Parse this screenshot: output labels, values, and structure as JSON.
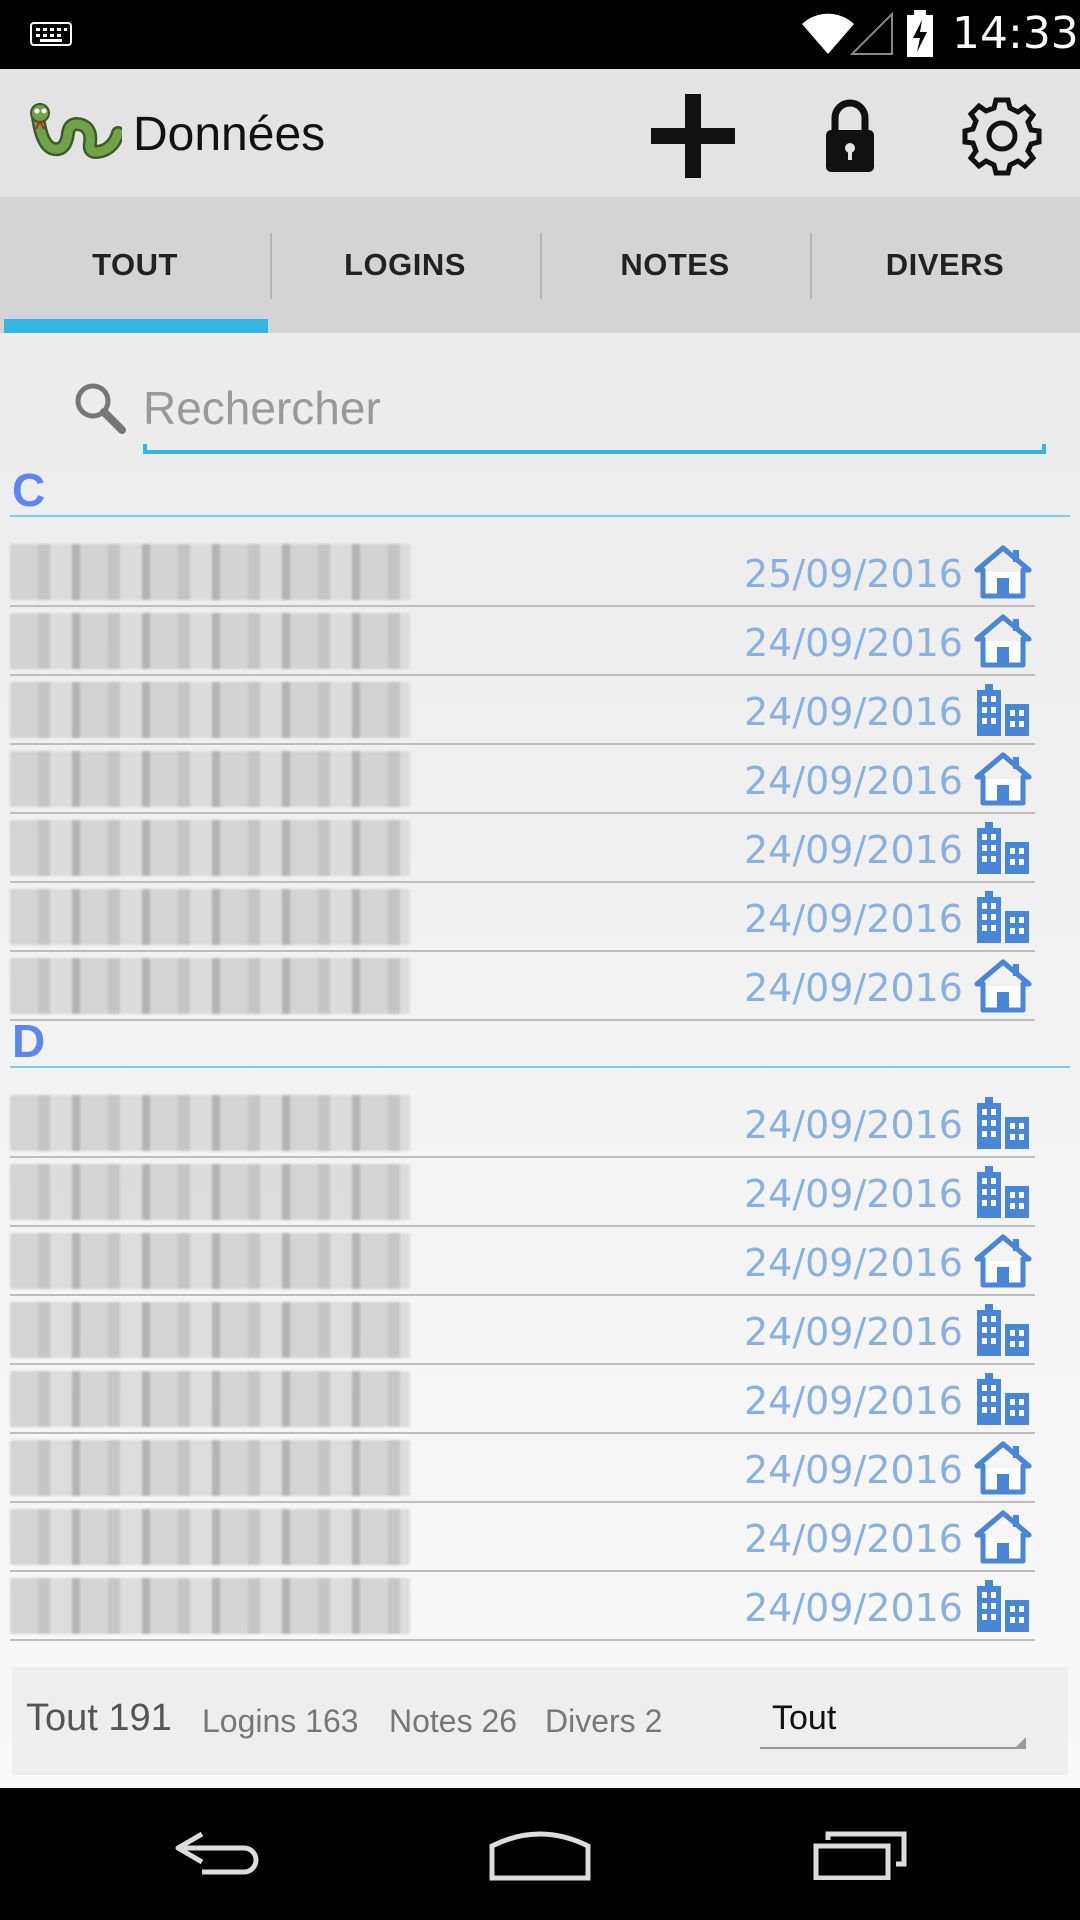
{
  "status_bar": {
    "time": "14:33",
    "icons": [
      "keyboard-icon",
      "wifi-icon",
      "signal-icon",
      "battery-icon"
    ]
  },
  "action_bar": {
    "title": "Données",
    "logo": "snake-logo",
    "actions": [
      "add-icon",
      "lock-icon",
      "gear-icon"
    ]
  },
  "tabs": [
    {
      "label": "TOUT",
      "active": true
    },
    {
      "label": "LOGINS",
      "active": false
    },
    {
      "label": "NOTES",
      "active": false
    },
    {
      "label": "DIVERS",
      "active": false
    }
  ],
  "search": {
    "placeholder": "Rechercher",
    "value": ""
  },
  "sections": [
    {
      "letter": "C",
      "items": [
        {
          "date": "25/09/2016",
          "icon": "home"
        },
        {
          "date": "24/09/2016",
          "icon": "home"
        },
        {
          "date": "24/09/2016",
          "icon": "building"
        },
        {
          "date": "24/09/2016",
          "icon": "home"
        },
        {
          "date": "24/09/2016",
          "icon": "building"
        },
        {
          "date": "24/09/2016",
          "icon": "building"
        },
        {
          "date": "24/09/2016",
          "icon": "home"
        }
      ]
    },
    {
      "letter": "D",
      "items": [
        {
          "date": "24/09/2016",
          "icon": "building"
        },
        {
          "date": "24/09/2016",
          "icon": "building"
        },
        {
          "date": "24/09/2016",
          "icon": "home"
        },
        {
          "date": "24/09/2016",
          "icon": "building"
        },
        {
          "date": "24/09/2016",
          "icon": "building"
        },
        {
          "date": "24/09/2016",
          "icon": "home"
        },
        {
          "date": "24/09/2016",
          "icon": "home"
        },
        {
          "date": "24/09/2016",
          "icon": "building"
        }
      ]
    }
  ],
  "footer": {
    "total": "Tout 191",
    "logins": "Logins 163",
    "notes": "Notes 26",
    "divers": "Divers 2",
    "filter_value": "Tout"
  },
  "colors": {
    "accent": "#33b5e5",
    "section_letter": "#5e86f0",
    "date": "#8ab0e0",
    "item_icon": "#4a86d8"
  },
  "nav_bar": [
    "back-icon",
    "home-icon",
    "recent-apps-icon"
  ]
}
